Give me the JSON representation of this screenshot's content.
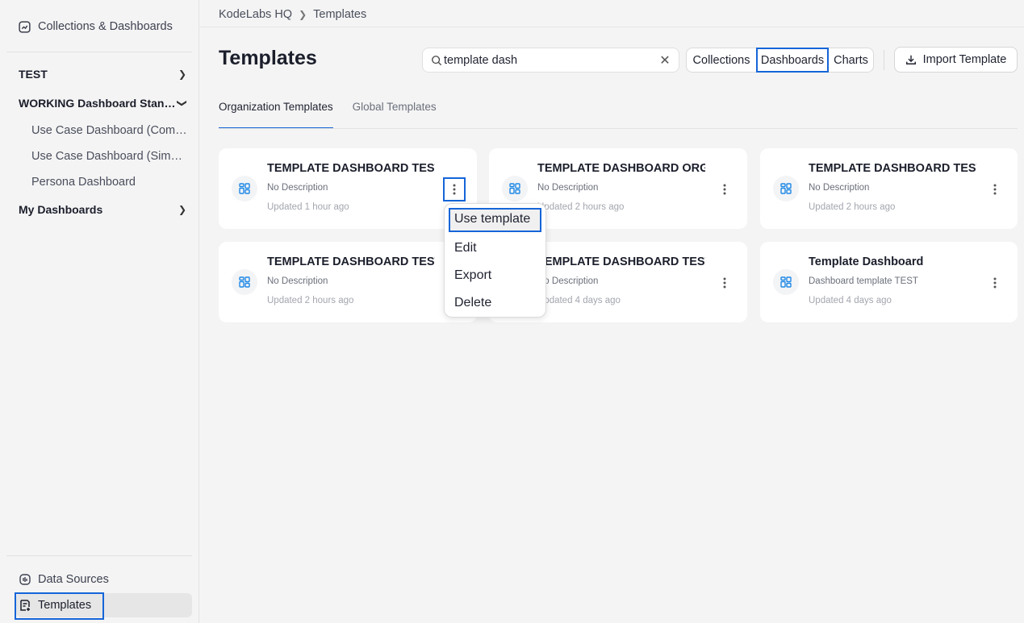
{
  "sidebar": {
    "top_item": "Collections & Dashboards",
    "groups": [
      {
        "label": "TEST"
      },
      {
        "label": "WORKING Dashboard Stan…"
      },
      {
        "label": "My Dashboards"
      }
    ],
    "sub_items": [
      "Use Case Dashboard (Com…",
      "Use Case Dashboard (Simpl…",
      "Persona Dashboard"
    ],
    "bottom_items": [
      "Data Sources",
      "Templates"
    ]
  },
  "breadcrumb": [
    "KodeLabs HQ",
    "Templates"
  ],
  "page_title": "Templates",
  "search": {
    "value": "template dash"
  },
  "filters": [
    "Collections",
    "Dashboards",
    "Charts"
  ],
  "selected_filter": "Dashboards",
  "import_button": "Import Template",
  "tabs": [
    "Organization Templates",
    "Global Templates"
  ],
  "active_tab": "Organization Templates",
  "cards": [
    {
      "title": "TEMPLATE DASHBOARD TEST",
      "description": "No Description",
      "updated": "Updated 1 hour ago"
    },
    {
      "title": "TEMPLATE DASHBOARD ORG",
      "description": "No Description",
      "updated": "Updated 2 hours ago"
    },
    {
      "title": "TEMPLATE DASHBOARD TEST",
      "description": "No Description",
      "updated": "Updated 2 hours ago"
    },
    {
      "title": "TEMPLATE DASHBOARD TEST",
      "description": "No Description",
      "updated": "Updated 2 hours ago"
    },
    {
      "title": "TEMPLATE DASHBOARD TEST",
      "description": "No Description",
      "updated": "Updated 4 days ago"
    },
    {
      "title": "Template Dashboard",
      "description": "Dashboard template TEST",
      "updated": "Updated 4 days ago"
    }
  ],
  "context_menu": [
    "Use template",
    "Edit",
    "Export",
    "Delete"
  ],
  "colors": {
    "accent": "#1565d8",
    "icon_blue": "#1e88e5"
  }
}
